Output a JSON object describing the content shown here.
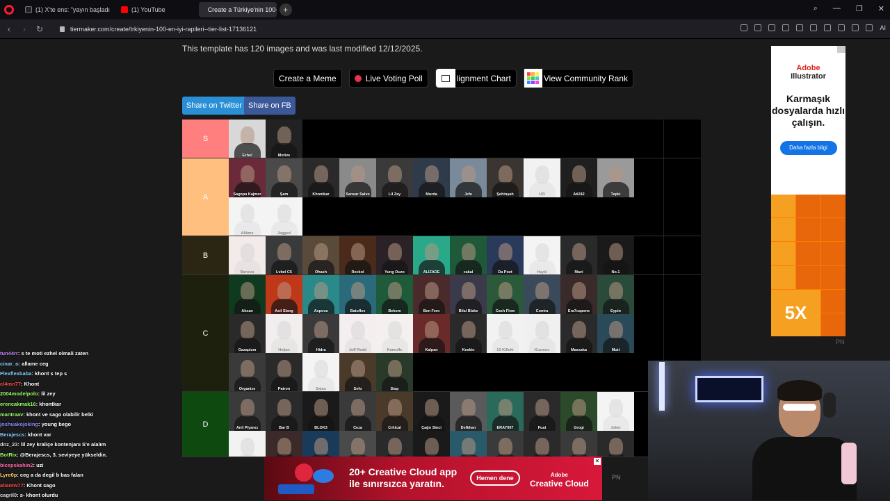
{
  "browser": {
    "tabs": [
      {
        "label": "(1) X'te ens: \"yayın başladı",
        "icon_color": "#222"
      },
      {
        "label": "(1) YouTube",
        "icon_color": "#ff0000"
      },
      {
        "label": "Create a Türkiye'nin 100-",
        "icon_color": "#555"
      }
    ],
    "url": "tiermaker.com/create/trkiyenin-100-en-iyi-rapileri--tier-list-17136121",
    "ai_label": "AI"
  },
  "page": {
    "template_info": "This template has 120 images and was last modified 12/12/2025.",
    "actions": {
      "create_meme": "Create a Meme",
      "live_voting": "Live Voting Poll",
      "alignment_chart": "lignment Chart",
      "community_rank": "View Community Rank"
    },
    "share_twitter": "Share on Twitter",
    "share_fb": "Share on FB"
  },
  "tiers": [
    {
      "label": "S",
      "color": "#ff7f7f",
      "items": [
        {
          "name": "Ezhel",
          "bg": "#d8d8d8",
          "light": false
        },
        {
          "name": "Motive",
          "bg": "#222222",
          "light": false
        }
      ]
    },
    {
      "label": "A",
      "color": "#ffbf7f",
      "items": [
        {
          "name": "Sagopa Kajmer",
          "bg": "#6b2a3a",
          "light": false
        },
        {
          "name": "Şam",
          "bg": "#4a4a4a",
          "light": false
        },
        {
          "name": "Khontkar",
          "bg": "#2a2a2a",
          "light": false
        },
        {
          "name": "Sansar Salvo",
          "bg": "#8a8a8a",
          "light": false
        },
        {
          "name": "Lil Zey",
          "bg": "#3a3a3a",
          "light": false
        },
        {
          "name": "Murda",
          "bg": "#2f3a4a",
          "light": false
        },
        {
          "name": "Jefe",
          "bg": "#7a8a9a",
          "light": false
        },
        {
          "name": "Şehinşah",
          "bg": "#3a3530",
          "light": false
        },
        {
          "name": "UZI",
          "bg": "#f2f2f2",
          "light": true
        },
        {
          "name": "Ati242",
          "bg": "#1f1f1f",
          "light": false
        },
        {
          "name": "Tepki",
          "bg": "#9a9a9a",
          "light": false
        },
        {
          "name": "Allâme",
          "bg": "#f4f4f4",
          "light": true
        },
        {
          "name": "Jagged",
          "bg": "#f4f4f4",
          "light": true
        }
      ]
    },
    {
      "label": "B",
      "color": "#2b2614",
      "items": [
        {
          "name": "Baneva",
          "bg": "#f3eaea",
          "light": true
        },
        {
          "name": "Lvbel C5",
          "bg": "#3a3a3a",
          "light": false
        },
        {
          "name": "Ohash",
          "bg": "#5a4a3a",
          "light": false
        },
        {
          "name": "Reckol",
          "bg": "#4a2a1a",
          "light": false
        },
        {
          "name": "Yung Ouzo",
          "bg": "#2a2226",
          "light": false
        },
        {
          "name": "ALIZADE",
          "bg": "#2aa88a",
          "light": false
        },
        {
          "name": "cakal",
          "bg": "#1e5a3a",
          "light": false
        },
        {
          "name": "Da Poet",
          "bg": "#2a3a5a",
          "light": false
        },
        {
          "name": "Hayki",
          "bg": "#f4f4f4",
          "light": true
        },
        {
          "name": "Mavi",
          "bg": "#2a2a2a",
          "light": false
        },
        {
          "name": "No.1",
          "bg": "#1a1a1a",
          "light": false
        }
      ]
    },
    {
      "label": "C",
      "color": "#1c200c",
      "items": [
        {
          "name": "Aksan",
          "bg": "#0f3a1f",
          "light": false
        },
        {
          "name": "Asil Slang",
          "bg": "#c0381a",
          "light": false
        },
        {
          "name": "Aspova",
          "bg": "#2a8a8a",
          "light": false
        },
        {
          "name": "Batuflex",
          "bg": "#2a6a7a",
          "light": false
        },
        {
          "name": "Bekom",
          "bg": "#1f5a3a",
          "light": false
        },
        {
          "name": "Ben Fero",
          "bg": "#4a2a2a",
          "light": false
        },
        {
          "name": "Bilal Blake",
          "bg": "#3a3a4a",
          "light": false
        },
        {
          "name": "Cash Flow",
          "bg": "#2a5a3a",
          "light": false
        },
        {
          "name": "Contra",
          "bg": "#3a4a5a",
          "light": false
        },
        {
          "name": "Era7capone",
          "bg": "#3a2a2a",
          "light": false
        },
        {
          "name": "Eypio",
          "bg": "#2a4a3a",
          "light": false
        },
        {
          "name": "Gazapizm",
          "bg": "#2a2a2a",
          "light": false
        },
        {
          "name": "Heijan",
          "bg": "#f2eeee",
          "light": true
        },
        {
          "name": "Hidra",
          "bg": "#3a3a3a",
          "light": false
        },
        {
          "name": "Jeff Redd",
          "bg": "#f4eef0",
          "light": true
        },
        {
          "name": "Kamufle",
          "bg": "#f4f0f0",
          "light": true
        },
        {
          "name": "Kalpan",
          "bg": "#6a2a2a",
          "light": false
        },
        {
          "name": "Keskin",
          "bg": "#2a2a2a",
          "light": false
        },
        {
          "name": "13 Killoki",
          "bg": "#f2f2f2",
          "light": true
        },
        {
          "name": "Kozmos",
          "bg": "#f0f0f0",
          "light": true
        },
        {
          "name": "Massaka",
          "bg": "#2a2a2a",
          "light": false
        },
        {
          "name": "Mutt",
          "bg": "#2a4a5a",
          "light": false
        },
        {
          "name": "Organize",
          "bg": "#3a3a3a",
          "light": false
        },
        {
          "name": "Patron",
          "bg": "#2a2a2a",
          "light": false
        },
        {
          "name": "Saian",
          "bg": "#f4f4f4",
          "light": true
        },
        {
          "name": "Sefo",
          "bg": "#4a3a2a",
          "light": false
        },
        {
          "name": "Stap",
          "bg": "#2a3a2a",
          "light": false
        }
      ]
    },
    {
      "label": "D",
      "color": "#0e4a10",
      "items": [
        {
          "name": "Anil Piyancı",
          "bg": "#3a3a3a",
          "light": false
        },
        {
          "name": "Bar B",
          "bg": "#2a2a2a",
          "light": false
        },
        {
          "name": "BLOK3",
          "bg": "#1a1a1a",
          "light": false
        },
        {
          "name": "Ceza",
          "bg": "#3a3a3a",
          "light": false
        },
        {
          "name": "Critical",
          "bg": "#4a3a2a",
          "light": false
        },
        {
          "name": "Çağrı Sinci",
          "bg": "#1a1a1a",
          "light": false
        },
        {
          "name": "Defkhan",
          "bg": "#5a5a5a",
          "light": false
        },
        {
          "name": "ERAY067",
          "bg": "#2a6a5a",
          "light": false
        },
        {
          "name": "Fuat",
          "bg": "#2a2a2a",
          "light": false
        },
        {
          "name": "Grogi",
          "bg": "#2a4a2a",
          "light": false
        },
        {
          "name": "Joker",
          "bg": "#f4f4f4",
          "light": true
        },
        {
          "name": "",
          "bg": "#f2f2f2",
          "light": true
        },
        {
          "name": "",
          "bg": "#3a2a2a",
          "light": false
        },
        {
          "name": "",
          "bg": "#1a3a5a",
          "light": false
        },
        {
          "name": "",
          "bg": "#4a4a4a",
          "light": false
        },
        {
          "name": "",
          "bg": "#2a2a2a",
          "light": false
        },
        {
          "name": "",
          "bg": "#1a1a1a",
          "light": false
        },
        {
          "name": "",
          "bg": "#2a5a6a",
          "light": false
        },
        {
          "name": "",
          "bg": "#3a3a3a",
          "light": false
        },
        {
          "name": "",
          "bg": "#2a2a2a",
          "light": false
        },
        {
          "name": "",
          "bg": "#3a3a3a",
          "light": false
        },
        {
          "name": "",
          "bg": "#2a2a2a",
          "light": false
        }
      ]
    }
  ],
  "side_ad": {
    "brand_1": "Adobe",
    "brand_2": "Illustrator",
    "headline": "Karmaşık dosyalarda hızlı çalışın.",
    "cta": "Daha fazla bilgi",
    "art_text": "5X",
    "pn": "PN"
  },
  "bottom_ad": {
    "text_line1": "20+ Creative Cloud app",
    "text_line2": "ile sınırsızca yaratın.",
    "cta": "Hemen dene",
    "brand_1": "Adobe",
    "brand_2": "Creative Cloud",
    "pn": "PN"
  },
  "chat": [
    {
      "user": "tun44rr",
      "text": "s te moti ezhel olmali zaten",
      "color": "#c88aff"
    },
    {
      "user": "cinar_o",
      "text": "allame ceg",
      "color": "#8ad0ff"
    },
    {
      "user": "Flexflexbaba",
      "text": "khont s tep s",
      "color": "#8ad0ff"
    },
    {
      "user": "cl4mn77",
      "text": "Khont",
      "color": "#ff4a4a"
    },
    {
      "user": "2004modelpolo",
      "text": "lil zey",
      "color": "#9aff6a"
    },
    {
      "user": "erencakmak16",
      "text": "khontkar",
      "color": "#9aff6a"
    },
    {
      "user": "mantraav",
      "text": "khont ve sago olabilir belki",
      "color": "#9aff6a"
    },
    {
      "user": "joshuakojoking",
      "text": "young bego",
      "color": "#8a8aff"
    },
    {
      "user": "Berajescs",
      "text": "khont var",
      "color": "#8ad0ff"
    },
    {
      "user": "dnz_23",
      "text": "lil zey kraliçe kontenjanı S'e alalım",
      "color": "#dddddd"
    },
    {
      "user": "BotRix",
      "text": "@Berajescs, 3. seviyeye yükseldin.",
      "color": "#9aff6a"
    },
    {
      "user": "bicepskahin2",
      "text": "uzi",
      "color": "#ff6aaa"
    },
    {
      "user": "Lyre0p",
      "text": "ceg a da degil b bas falan",
      "color": "#ffd36a"
    },
    {
      "user": "aliantw77",
      "text": "Khont sago",
      "color": "#ff4a4a"
    },
    {
      "user": "cagril0",
      "text": "s- khont olurdu",
      "color": "#dddddd"
    }
  ]
}
